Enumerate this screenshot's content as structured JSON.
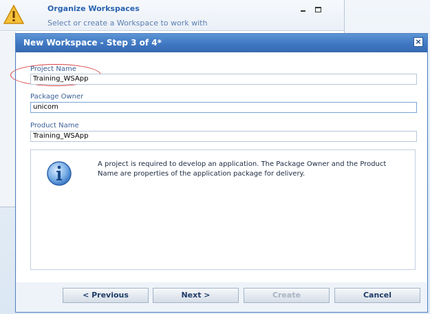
{
  "background_window": {
    "title": "Organize Workspaces",
    "subtitle": "Select or create a Workspace to work with",
    "warning_icon": "warning-icon"
  },
  "dialog": {
    "title": "New Workspace - Step 3 of 4*",
    "close_label": "×",
    "fields": {
      "project_name": {
        "label": "Project Name",
        "value": "Training_WSApp"
      },
      "package_owner": {
        "label": "Package Owner",
        "value": "unicom"
      },
      "product_name": {
        "label": "Product Name",
        "value": "Training_WSApp"
      }
    },
    "info": {
      "icon": "info-icon",
      "text": "A project is required to develop an application. The Package Owner and the Product Name are properties of the application package for delivery."
    },
    "buttons": {
      "previous": "< Previous",
      "next": "Next >",
      "create": "Create",
      "cancel": "Cancel"
    }
  },
  "colors": {
    "titlebar": "#3f78c2",
    "link_blue": "#2a62b0",
    "highlight": "#d84040"
  }
}
